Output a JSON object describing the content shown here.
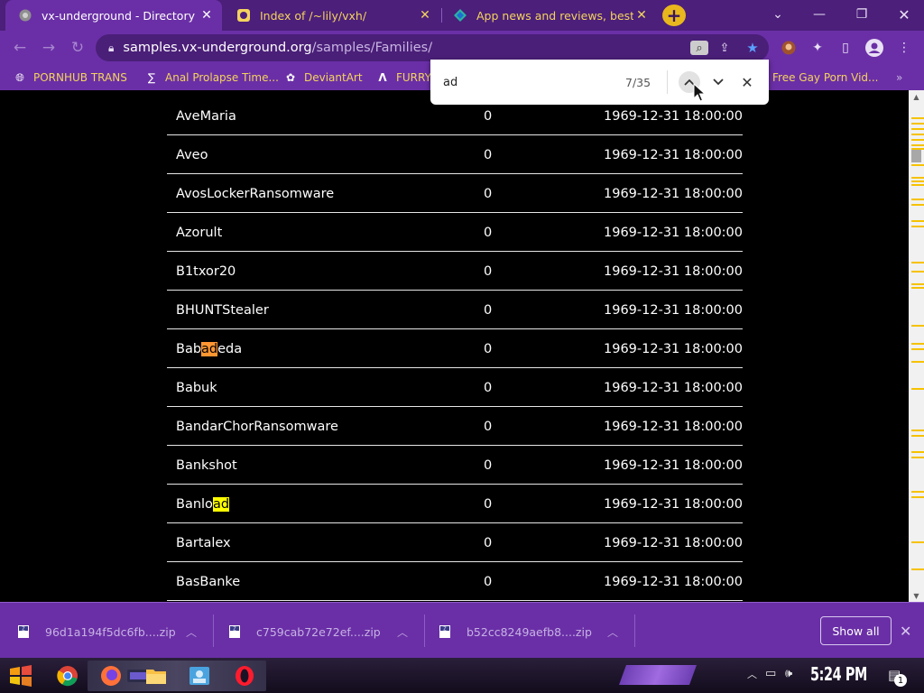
{
  "browser": {
    "tabs": [
      {
        "title": "vx-underground - Directory",
        "active": true,
        "icon": "chrome-icon"
      },
      {
        "title": "Index of /~lily/vxh/",
        "active": false,
        "icon": "site-icon"
      },
      {
        "title": "App news and reviews, best sof",
        "active": false,
        "icon": "app-site-icon"
      }
    ],
    "new_tab_label": "+",
    "url_host": "samples.vx-underground.org",
    "url_path": "/samples/Families/"
  },
  "bookmarks": [
    {
      "label": "PORNHUB TRANS",
      "icon": "globe-icon"
    },
    {
      "label": "Anal Prolapse Time...",
      "icon": "bracket-icon"
    },
    {
      "label": "DeviantArt",
      "icon": "deviantart-icon"
    },
    {
      "label": "FURRY",
      "icon": "lambda-icon"
    },
    {
      "label": "Free Gay Porn Vid...",
      "icon": "site-icon"
    }
  ],
  "find": {
    "query": "ad",
    "count": "7/35"
  },
  "listing": [
    {
      "name": "AveMaria",
      "size": "0",
      "date": "1969-12-31 18:00:00"
    },
    {
      "name": "Aveo",
      "size": "0",
      "date": "1969-12-31 18:00:00"
    },
    {
      "name": "AvosLockerRansomware",
      "size": "0",
      "date": "1969-12-31 18:00:00"
    },
    {
      "name": "Azorult",
      "size": "0",
      "date": "1969-12-31 18:00:00"
    },
    {
      "name": "B1txor20",
      "size": "0",
      "date": "1969-12-31 18:00:00"
    },
    {
      "name": "BHUNTStealer",
      "size": "0",
      "date": "1969-12-31 18:00:00"
    },
    {
      "name": "Babadeda",
      "size": "0",
      "date": "1969-12-31 18:00:00",
      "match": "active",
      "pre": "Bab",
      "hit": "ad",
      "post": "eda"
    },
    {
      "name": "Babuk",
      "size": "0",
      "date": "1969-12-31 18:00:00"
    },
    {
      "name": "BandarChorRansomware",
      "size": "0",
      "date": "1969-12-31 18:00:00"
    },
    {
      "name": "Bankshot",
      "size": "0",
      "date": "1969-12-31 18:00:00"
    },
    {
      "name": "Banload",
      "size": "0",
      "date": "1969-12-31 18:00:00",
      "match": "passive",
      "pre": "Banlo",
      "hit": "ad",
      "post": ""
    },
    {
      "name": "Bartalex",
      "size": "0",
      "date": "1969-12-31 18:00:00"
    },
    {
      "name": "BasBanke",
      "size": "0",
      "date": "1969-12-31 18:00:00"
    }
  ],
  "downloads": [
    {
      "name": "96d1a194f5dc6fb....zip"
    },
    {
      "name": "c759cab72e72ef....zip"
    },
    {
      "name": "b52cc8249aefb8....zip"
    }
  ],
  "download_shelf": {
    "show_all": "Show all"
  },
  "taskbar": {
    "clock": "5:24 PM",
    "notifications": "1"
  },
  "colors": {
    "tab_strip": "#4b1f7a",
    "toolbar": "#6a2fa6",
    "accent_yellow": "#f4d35e",
    "find_active": "#ff9632",
    "find_passive": "#ffff00"
  }
}
